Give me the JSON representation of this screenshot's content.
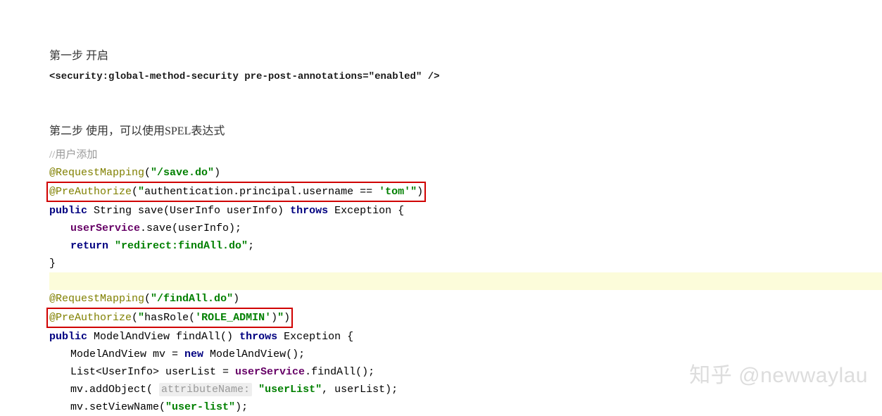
{
  "step1": {
    "title": "第一步 开启",
    "xml": "<security:global-method-security pre-post-annotations=\"enabled\" />"
  },
  "step2": {
    "title": "第二步 使用，可以使用SPEL表达式",
    "comment": "//用户添加",
    "rm_anno": "@RequestMapping",
    "pre_auth_anno": "@PreAuthorize",
    "save_path": "\"/save.do\"",
    "save_spel_prefix": "authentication.principal.username ==",
    "save_spel_val": "'tom'",
    "kw_public": "public",
    "kw_throws": "throws",
    "kw_return": "return",
    "kw_new": "new",
    "save_sig_mid": " String save(UserInfo userInfo) ",
    "exception_brace": " Exception {",
    "user_service": "userService",
    "save_call": ".save(userInfo);",
    "redirect_str": "\"redirect:findAll.do\"",
    "close_brace": "}",
    "findall_path": "\"/findAll.do\"",
    "findall_spel_prefix": "hasRole(",
    "findall_spel_val": "'ROLE_ADMIN'",
    "findall_sig_mid": " ModelAndView findAll() ",
    "mv_line": "ModelAndView mv = ",
    "mv_ctor": " ModelAndView();",
    "list_line_pre": "List<UserInfo> userList = ",
    "list_line_post": ".findAll();",
    "addobj_pre": "mv.addObject( ",
    "attr_name_hint": "attributeName:",
    "userlist_str": "\"userList\"",
    "addobj_post": ", userList);",
    "setview_pre": "mv.setViewName(",
    "userlist_view_str": "\"user-list\"",
    "setview_post": ");"
  },
  "watermark": "知乎 @newwaylau"
}
